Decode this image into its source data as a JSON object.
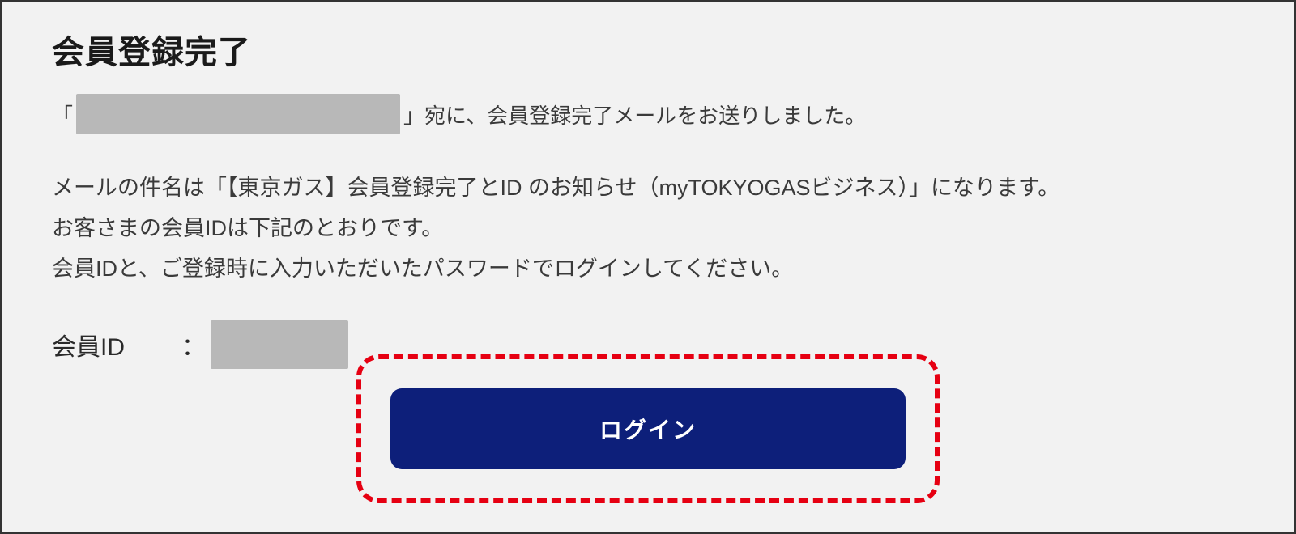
{
  "title": "会員登録完了",
  "intro": {
    "prefix": "「",
    "suffix": "」宛に、会員登録完了メールをお送りしました。"
  },
  "body": {
    "line1": "メールの件名は「【東京ガス】会員登録完了とID のお知らせ（myTOKYOGASビジネス）」になります。",
    "line2": "お客さまの会員IDは下記のとおりです。",
    "line3": "会員IDと、ご登録時に入力いただいたパスワードでログインしてください。"
  },
  "member_id": {
    "label": "会員ID",
    "separator": "："
  },
  "login_button": "ログイン"
}
